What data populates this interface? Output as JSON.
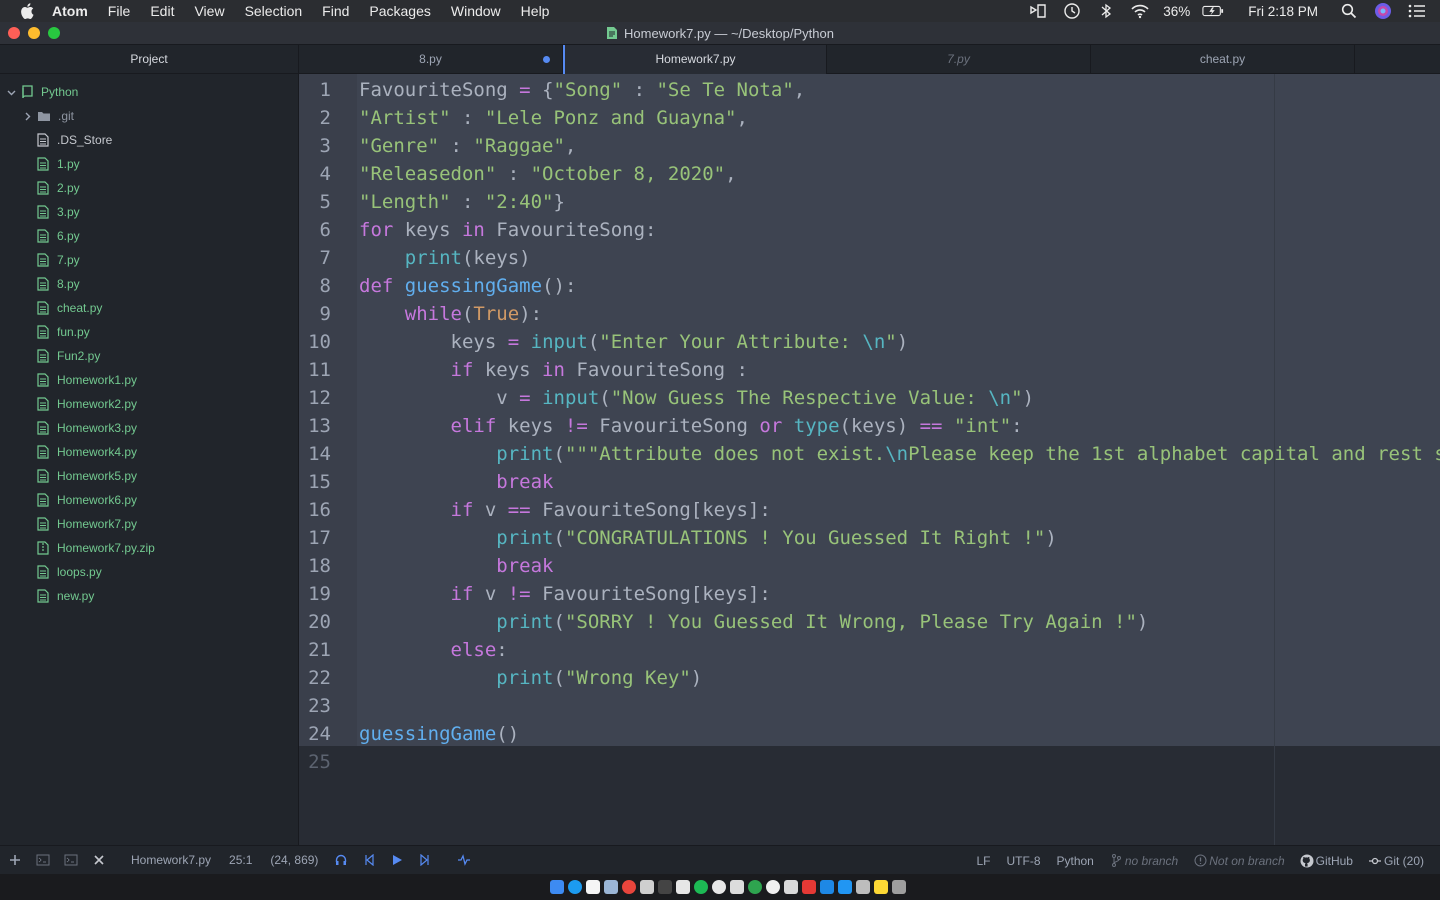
{
  "menubar": {
    "app_name": "Atom",
    "items": [
      "File",
      "Edit",
      "View",
      "Selection",
      "Find",
      "Packages",
      "Window",
      "Help"
    ],
    "battery": "36%",
    "clock": "Fri 2:18 PM"
  },
  "window": {
    "title": "Homework7.py — ~/Desktop/Python"
  },
  "sidebar": {
    "title": "Project",
    "root": "Python",
    "folder": ".git",
    "files": [
      ".DS_Store",
      "1.py",
      "2.py",
      "3.py",
      "6.py",
      "7.py",
      "8.py",
      "cheat.py",
      "fun.py",
      "Fun2.py",
      "Homework1.py",
      "Homework2.py",
      "Homework3.py",
      "Homework4.py",
      "Homework5.py",
      "Homework6.py",
      "Homework7.py",
      "Homework7.py.zip",
      "loops.py",
      "new.py"
    ]
  },
  "tabs": [
    {
      "label": "8.py",
      "modified": true
    },
    {
      "label": "Homework7.py",
      "active": true
    },
    {
      "label": "7.py",
      "pending": true
    },
    {
      "label": "cheat.py"
    }
  ],
  "editor": {
    "line_numbers": [
      "1",
      "2",
      "3",
      "4",
      "5",
      "6",
      "7",
      "8",
      "9",
      "10",
      "11",
      "12",
      "13",
      "14",
      "15",
      "16",
      "17",
      "18",
      "19",
      "20",
      "21",
      "22",
      "23",
      "24",
      "25"
    ],
    "line14_full": "print(\"\"\"Attribute does not exist.\\nPlease keep the 1st alphabet capital and rest s"
  },
  "statusbar": {
    "file": "Homework7.py",
    "cursor": "25:1",
    "selection": "(24, 869)",
    "line_ending": "LF",
    "encoding": "UTF-8",
    "grammar": "Python",
    "branch": "no branch",
    "remote": "Not on branch",
    "github": "GitHub",
    "git": "Git (20)"
  },
  "colors": {
    "accent": "#568af2",
    "file_green": "#73c990",
    "keyword": "#c678dd",
    "function": "#61afef",
    "string": "#98c379",
    "builtin": "#56b6c2",
    "constant": "#d19a66"
  }
}
